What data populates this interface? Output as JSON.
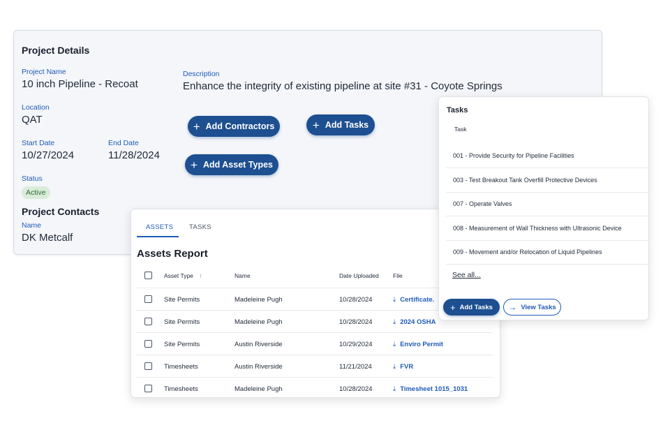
{
  "project": {
    "section_title": "Project Details",
    "name_label": "Project Name",
    "name_value": "10 inch Pipeline - Recoat",
    "description_label": "Description",
    "description_value": "Enhance the integrity of existing pipeline at site #31 - Coyote Springs",
    "location_label": "Location",
    "location_value": "QAT",
    "start_label": "Start Date",
    "start_value": "10/27/2024",
    "end_label": "End Date",
    "end_value": "11/28/2024",
    "status_label": "Status",
    "status_value": "Active",
    "contacts_title": "Project Contacts",
    "contact_name_label": "Name",
    "contact_name_value": "DK Metcalf",
    "buttons": {
      "add_contractors": "Add Contractors",
      "add_tasks": "Add Tasks",
      "add_asset_types": "Add Asset Types"
    }
  },
  "assets": {
    "tabs": [
      "ASSETS",
      "TASKS"
    ],
    "title": "Assets Report",
    "columns": [
      "Asset Type",
      "Name",
      "Date Uploaded",
      "File"
    ],
    "rows": [
      {
        "type": "Site Permits",
        "name": "Madeleine Pugh",
        "date": "10/28/2024",
        "file": "Certificate."
      },
      {
        "type": "Site Permits",
        "name": "Madeleine Pugh",
        "date": "10/28/2024",
        "file": "2024 OSHA"
      },
      {
        "type": "Site Permits",
        "name": "Austin Riverside",
        "date": "10/29/2024",
        "file": "Enviro Permit"
      },
      {
        "type": "Timesheets",
        "name": "Austin Riverside",
        "date": "11/21/2024",
        "file": "FVR"
      },
      {
        "type": "Timesheets",
        "name": "Madeleine Pugh",
        "date": "10/28/2024",
        "file": "Timesheet 1015_1031"
      }
    ]
  },
  "tasks": {
    "title": "Tasks",
    "column": "Task",
    "items": [
      "001 - Provide Security for Pipeline Facilities",
      "003 - Test Breakout Tank Overfill Protective Devices",
      "007 - Operate Valves",
      "008 - Measurement of Wall Thickness with Ultrasonic Device",
      "009 - Movement and/or Relocation of Liquid Pipelines"
    ],
    "see_all": "See all...",
    "add_button": "Add Tasks",
    "view_button": "View Tasks"
  },
  "icons": {
    "plus": "plus-icon",
    "sort": "arrow-up-icon",
    "download": "download-icon",
    "arrow_right": "arrow-right-icon"
  },
  "colors": {
    "primary": "#1d4f91",
    "link": "#1e5bb8",
    "status_bg": "#d9ecd9",
    "status_text": "#2e6b2e"
  }
}
